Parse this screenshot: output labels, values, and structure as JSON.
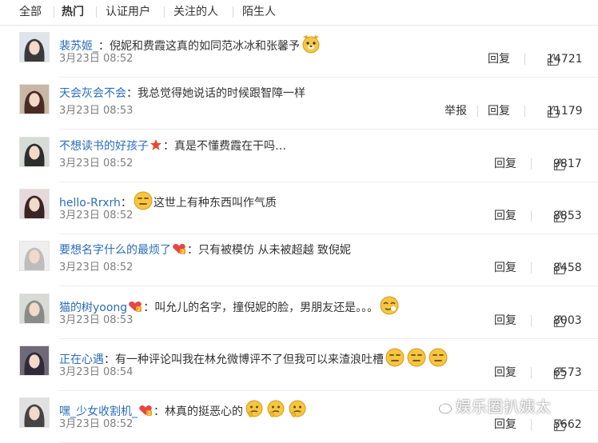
{
  "tabs": [
    {
      "label": "全部",
      "active": false
    },
    {
      "label": "热门",
      "active": true
    },
    {
      "label": "认证用户",
      "active": false
    },
    {
      "label": "关注的人",
      "active": false
    },
    {
      "label": "陌生人",
      "active": false
    }
  ],
  "actions": {
    "reply": "回复",
    "report": "举报"
  },
  "comments": [
    {
      "user": "裴苏姬_",
      "sep": "：",
      "text": "倪妮和费霞这真的如同范冰冰和张馨予",
      "time": "3月23日 08:52",
      "likes": "14721",
      "emojis": [
        "dog-face-emoji"
      ],
      "badge": null,
      "report": false
    },
    {
      "user": "天会灰会不会",
      "sep": "：",
      "text": "我总觉得她说话的时候跟智障一样",
      "time": "3月23日 08:53",
      "likes": "11179",
      "emojis": [],
      "badge": null,
      "report": true
    },
    {
      "user": "不想读书的好孩子",
      "sep": "：",
      "text": "真是不懂费霞在干吗…",
      "time": "3月23日 08:52",
      "likes": "9817",
      "emojis": [],
      "badge": "star-badge-icon",
      "report": false
    },
    {
      "user": "hello-Rrxrh",
      "sep": "：",
      "text": "这世上有种东西叫作气质",
      "time": "3月23日 08:52",
      "likes": "8853",
      "emojis": [
        "meh-face-emoji"
      ],
      "emoji_before_text": true,
      "badge": null,
      "report": false
    },
    {
      "user": "要想名字什么的最烦了",
      "sep": "：",
      "text": "只有被模仿 从未被超越 致倪妮",
      "time": "3月23日 08:52",
      "likes": "8458",
      "emojis": [],
      "badge": "heart-badge-icon",
      "report": false
    },
    {
      "user": "猫的树yoong",
      "sep": "：",
      "text": "叫允儿的名字，撞倪妮的脸，男朋友还是。。。",
      "time": "3月23日 08:53",
      "likes": "8003",
      "emojis": [
        "smirk-face-emoji"
      ],
      "badge": "heart-badge-icon",
      "report": false
    },
    {
      "user": "正在心遇",
      "sep": "：",
      "text": "有一种评论叫我在林允微博评不了但我可以来渣浪吐槽",
      "time": "3月23日 08:54",
      "likes": "6573",
      "emojis": [
        "meh-face-emoji",
        "meh-face-emoji",
        "meh-face-emoji"
      ],
      "badge": null,
      "report": false
    },
    {
      "user": "嘿_少女收割机_",
      "sep": "：",
      "text": "林真的挺恶心的",
      "time": "3月23日 08:52",
      "likes": "5662",
      "emojis": [
        "thinking-face-emoji",
        "thinking-face-emoji",
        "thinking-face-emoji"
      ],
      "badge": "heart-badge-icon",
      "report": false
    }
  ],
  "watermark": {
    "text": "娱乐圈扒姨太"
  },
  "colors": {
    "username": "#2a6dbd",
    "meta": "#808080",
    "text": "#333333",
    "badge_star": "#e8472b",
    "badge_heart": "#f0a21e",
    "emoji": "#f6c641"
  }
}
